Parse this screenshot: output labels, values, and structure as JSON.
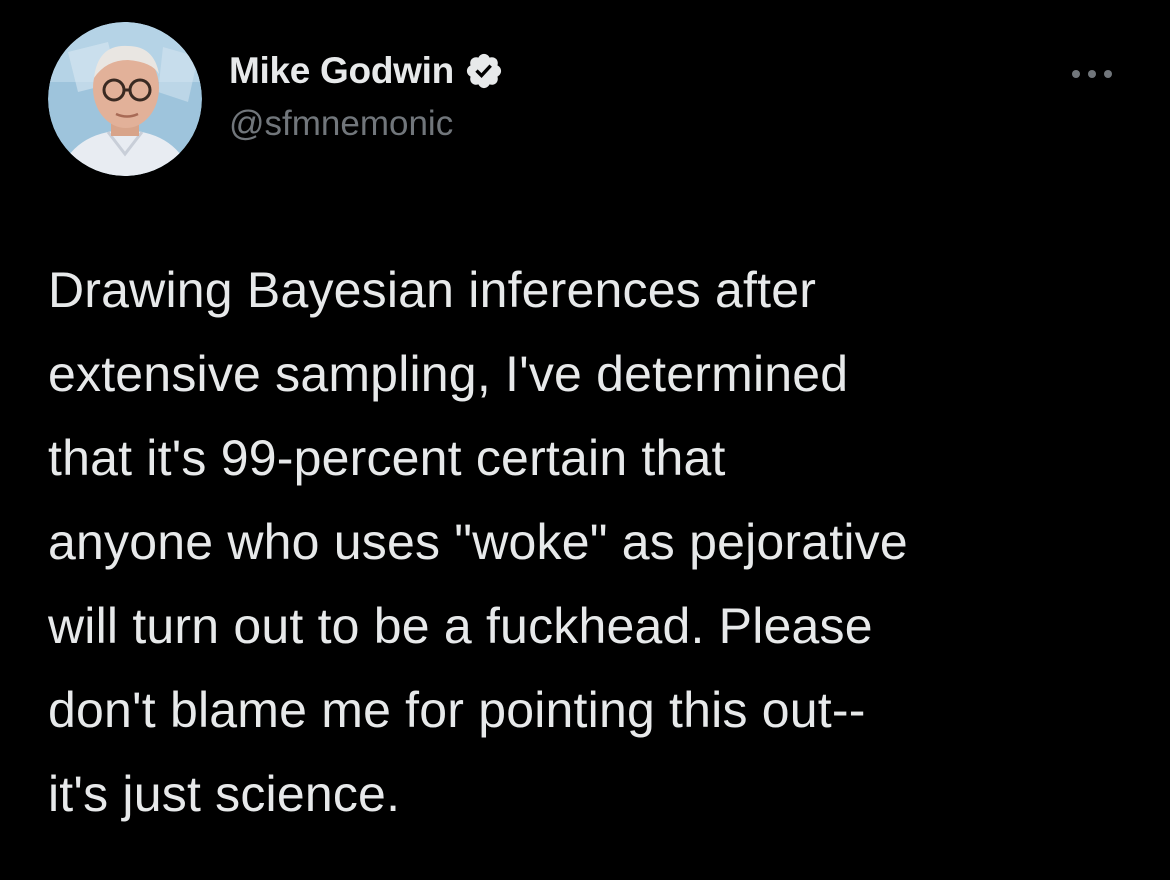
{
  "author": {
    "display_name": "Mike Godwin",
    "handle": "@sfmnemonic",
    "verified": true,
    "verified_icon": "verified-badge-icon",
    "avatar_icon": "profile-photo"
  },
  "actions": {
    "more_icon": "more-options-icon"
  },
  "tweet": {
    "lines": [
      "Drawing Bayesian inferences after",
      "extensive sampling, I've determined",
      "that it's 99-percent certain that",
      "anyone who uses \"woke\" as pejorative",
      "will turn out to be a fuckhead. Please",
      "don't blame me for pointing this out--",
      "it's just science."
    ]
  },
  "colors": {
    "background": "#000000",
    "text_primary": "#e7e9ea",
    "text_secondary": "#71767b"
  }
}
